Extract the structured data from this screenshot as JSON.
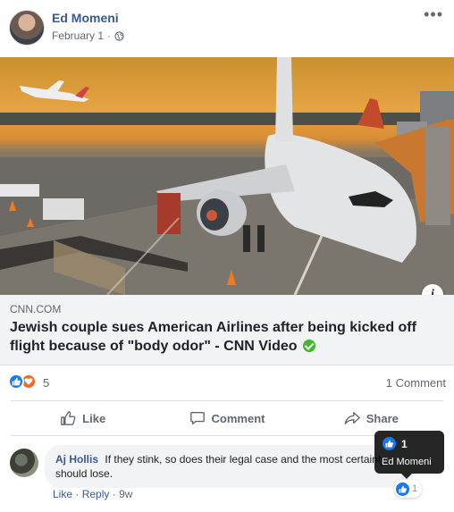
{
  "post": {
    "author": "Ed Momeni",
    "date": "February 1",
    "separator": "·",
    "privacy_icon": "globe-icon",
    "more_icon": "ellipsis-icon",
    "more_label": "•••"
  },
  "link": {
    "domain": "CNN.COM",
    "title": "Jewish couple sues American Airlines after being kicked off flight because of \"body odor\" - CNN Video",
    "info_label": "i",
    "verified_icon": "verified-check-icon"
  },
  "reactions": {
    "icons": [
      "like-reaction-icon",
      "love-reaction-icon"
    ],
    "count": "5",
    "comments": "1 Comment"
  },
  "actions": {
    "like": "Like",
    "comment": "Comment",
    "share": "Share"
  },
  "comment": {
    "author": "Aj Hollis",
    "text": "If they stink, so does their legal case and the most certainly should lose.",
    "like_link": "Like",
    "reply_link": "Reply",
    "dot": "·",
    "age": "9w",
    "like_count": "1"
  },
  "tooltip": {
    "count": "1",
    "name": "Ed Momeni"
  },
  "colors": {
    "accent": "#385898",
    "like_blue": "#1877f2",
    "love_orange": "#f0692a",
    "verified_green": "#42b72a"
  }
}
